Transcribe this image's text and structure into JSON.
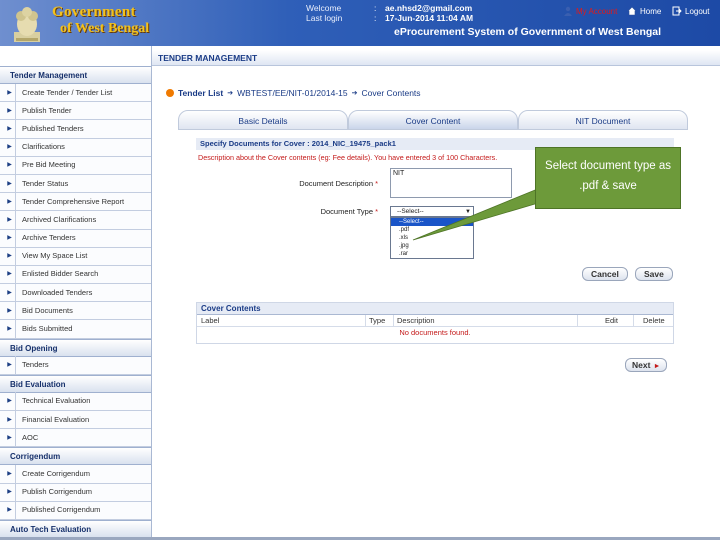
{
  "header": {
    "gov_line1": "Government",
    "gov_line2": "of West Bengal",
    "welcome_label": "Welcome",
    "welcome_value": "ae.nhsd2@gmail.com",
    "last_login_label": "Last login",
    "last_login_value": "17-Jun-2014 11:04 AM",
    "colon": ":",
    "my_account": "My Account",
    "home": "Home",
    "logout": "Logout",
    "system_title": "eProcurement System of Government of West Bengal",
    "icons": [
      "emblem-icon",
      "user-icon",
      "home-icon",
      "logout-icon"
    ]
  },
  "sidebar": {
    "sections": [
      {
        "title": "Tender Management",
        "items": [
          "Create Tender / Tender List",
          "Publish Tender",
          "Published Tenders",
          "Clarifications",
          "Pre Bid Meeting",
          "Tender Status",
          "Tender Comprehensive Report",
          "Archived Clarifications",
          "Archive Tenders",
          "View My Space List",
          "Enlisted Bidder Search",
          "Downloaded Tenders",
          "Bid Documents",
          "Bids Submitted"
        ]
      },
      {
        "title": "Bid Opening",
        "items": [
          "Tenders"
        ]
      },
      {
        "title": "Bid Evaluation",
        "items": [
          "Technical Evaluation",
          "Financial Evaluation",
          "AOC"
        ]
      },
      {
        "title": "Corrigendum",
        "items": [
          "Create Corrigendum",
          "Publish Corrigendum",
          "Published Corrigendum"
        ]
      },
      {
        "title": "Auto Tech Evaluation",
        "items": []
      }
    ]
  },
  "page": {
    "title": "TENDER MANAGEMENT",
    "breadcrumb": {
      "link": "Tender List",
      "middle": "WBTEST/EE/NIT-01/2014-15",
      "current": "Cover Contents"
    },
    "tabs": [
      "Basic Details",
      "Cover Content",
      "NIT Document"
    ],
    "spec_heading": "Specify Documents for Cover : 2014_NIC_19475_pack1",
    "desc_note": "Description about the Cover contents (eg: Fee details). You have entered 3  of 100 Characters.",
    "doc_desc_label": "Document Description",
    "doc_desc_value": "NIT",
    "doc_type_label": "Document Type",
    "required_mark": "*",
    "select_value": "--Select--",
    "select_options": [
      "--Select--",
      ".pdf",
      ".xls",
      ".jpg",
      ".rar"
    ],
    "cancel": "Cancel",
    "save": "Save",
    "cover_contents_title": "Cover Contents",
    "columns": [
      "Label",
      "Type",
      "Description",
      "Edit",
      "Delete"
    ],
    "empty_msg": "No documents found.",
    "next": "Next"
  },
  "callout": {
    "text": "Select document type as .pdf & save"
  },
  "colors": {
    "header_blue": "#1d4aa6",
    "gold": "#f4c21b",
    "callout_green": "#6d9a3a",
    "link_blue": "#1a3b86",
    "alert_red": "#c41a1a"
  }
}
